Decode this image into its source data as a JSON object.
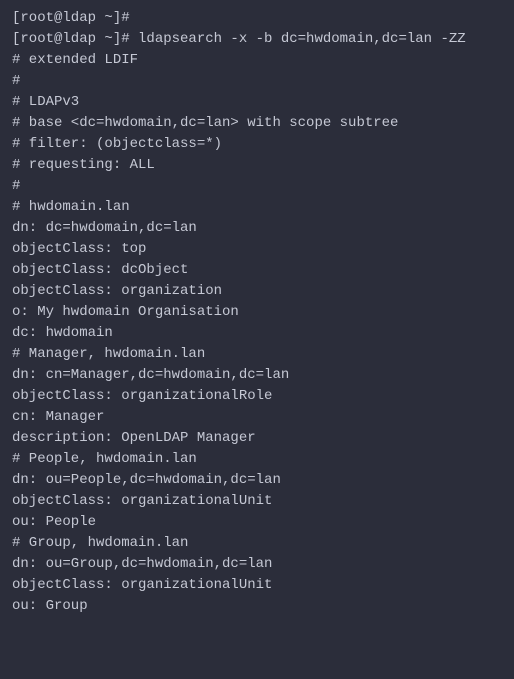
{
  "lines": [
    "[root@ldap ~]#",
    "[root@ldap ~]# ldapsearch -x -b dc=hwdomain,dc=lan -ZZ",
    "# extended LDIF",
    "#",
    "# LDAPv3",
    "# base <dc=hwdomain,dc=lan> with scope subtree",
    "# filter: (objectclass=*)",
    "# requesting: ALL",
    "#",
    "",
    "# hwdomain.lan",
    "dn: dc=hwdomain,dc=lan",
    "objectClass: top",
    "objectClass: dcObject",
    "objectClass: organization",
    "o: My hwdomain Organisation",
    "dc: hwdomain",
    "",
    "# Manager, hwdomain.lan",
    "dn: cn=Manager,dc=hwdomain,dc=lan",
    "objectClass: organizationalRole",
    "cn: Manager",
    "description: OpenLDAP Manager",
    "",
    "# People, hwdomain.lan",
    "dn: ou=People,dc=hwdomain,dc=lan",
    "objectClass: organizationalUnit",
    "ou: People",
    "",
    "# Group, hwdomain.lan",
    "dn: ou=Group,dc=hwdomain,dc=lan",
    "objectClass: organizationalUnit",
    "ou: Group"
  ]
}
